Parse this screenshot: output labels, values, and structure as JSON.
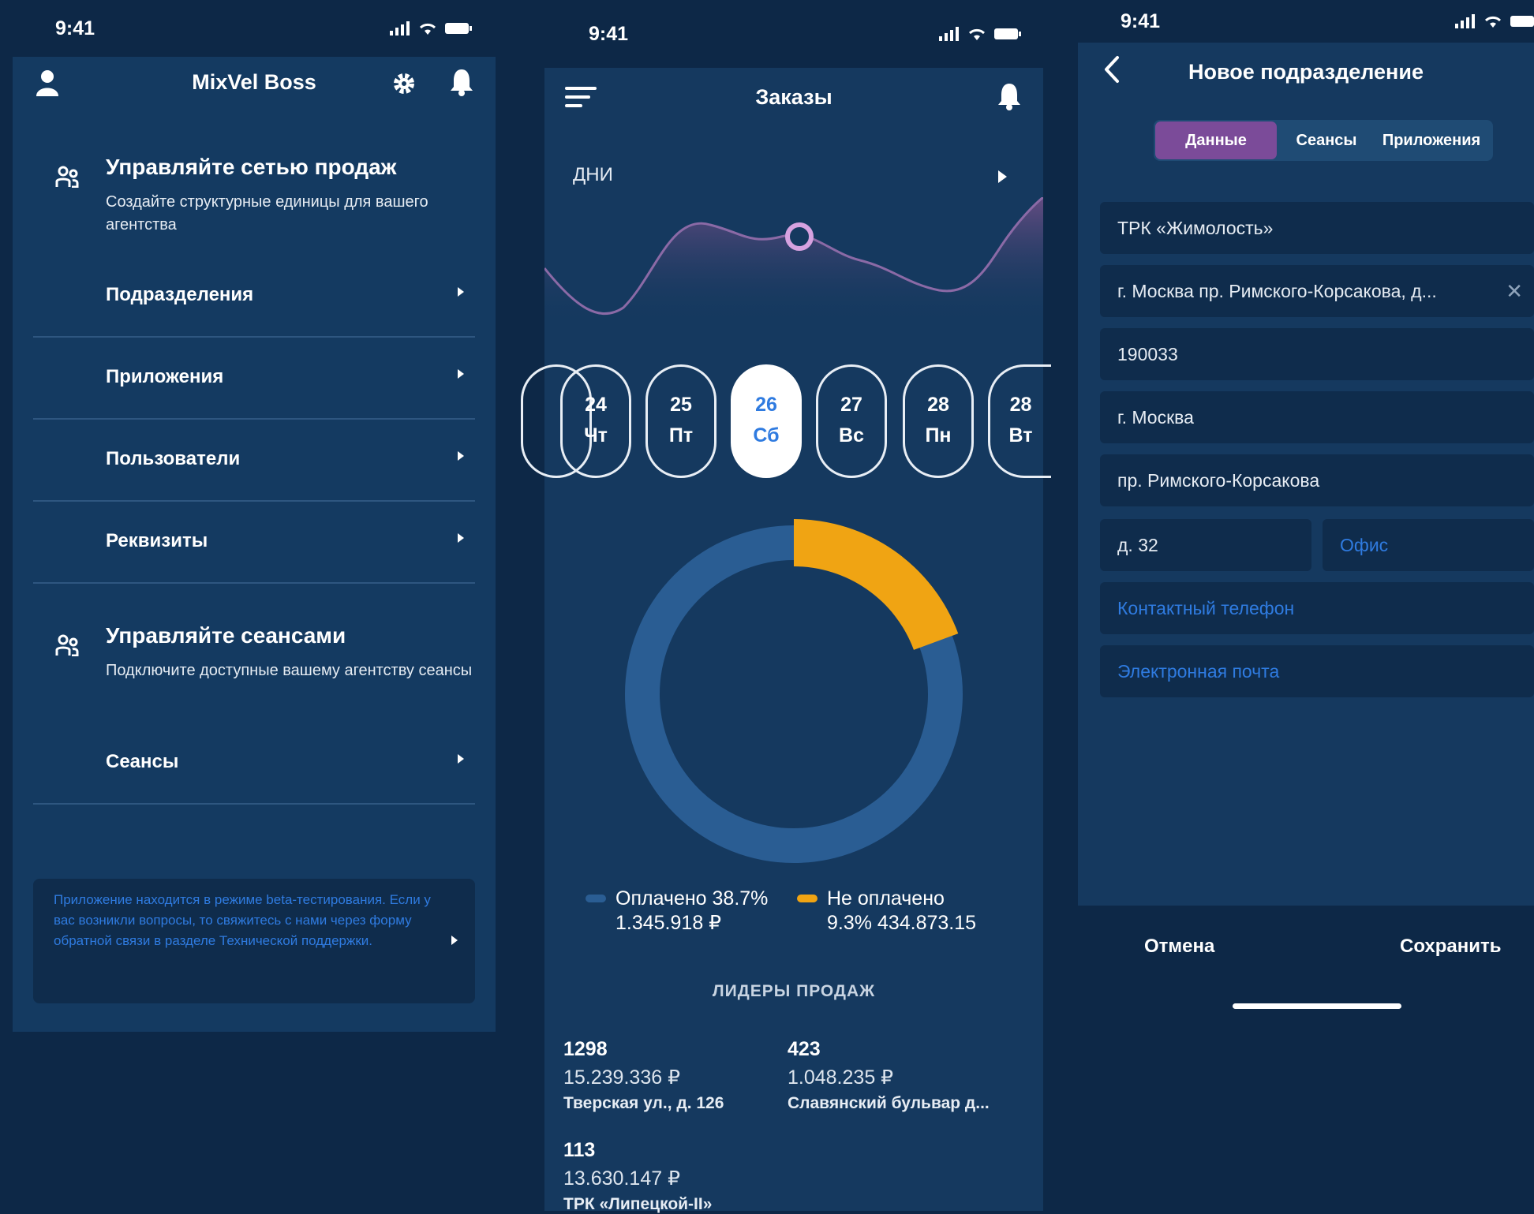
{
  "colors": {
    "background": "#0d2847",
    "panel": "#143a61",
    "accent_blue": "#2f7be0",
    "paid": "#2a5d93",
    "unpaid": "#f0a413",
    "tab_active": "#7b4b99"
  },
  "phone1": {
    "status_time": "9:41",
    "title": "MixVel Boss",
    "icons": {
      "left": "user-icon",
      "settings": "gear-icon",
      "notifications": "bell-icon"
    },
    "section1": {
      "title": "Управляйте сетью продаж",
      "desc": "Создайте структурные единицы для вашего агентства",
      "icon": "team-icon"
    },
    "menu1": [
      {
        "label": "Подразделения"
      },
      {
        "label": "Приложения"
      },
      {
        "label": "Пользователи"
      },
      {
        "label": "Реквизиты"
      }
    ],
    "section2": {
      "title": "Управляйте сеансами",
      "desc": "Подключите доступные вашему агентству сеансы",
      "icon": "team-icon"
    },
    "menu2": [
      {
        "label": "Сеансы"
      }
    ],
    "beta_text": "Приложение находится в режиме beta-тестирования. Если у вас возникли вопросы, то свяжитесь с нами через форму обратной связи в разделе Технической поддержки."
  },
  "phone2": {
    "status_time": "9:41",
    "title": "Заказы",
    "period_label": "ДНИ",
    "days": [
      {
        "num": "24",
        "wd": "Чт"
      },
      {
        "num": "25",
        "wd": "Пт"
      },
      {
        "num": "26",
        "wd": "Сб",
        "active": true
      },
      {
        "num": "27",
        "wd": "Вс"
      },
      {
        "num": "28",
        "wd": "Пн"
      },
      {
        "num": "28",
        "wd": "Вт"
      }
    ],
    "legend": [
      {
        "label": "Оплачено 38.7%",
        "value": "1.345.918 ₽",
        "color": "#2a5d93"
      },
      {
        "label": "Не оплачено",
        "value": "9.3% 434.873.15",
        "color": "#f0a413"
      }
    ],
    "leaders_title": "ЛИДЕРЫ ПРОДАЖ",
    "leaders": [
      {
        "count": "1298",
        "amount": "15.239.336 ₽",
        "address": "Тверская ул., д. 126"
      },
      {
        "count": "423",
        "amount": "1.048.235 ₽",
        "address": "Славянский бульвар д..."
      },
      {
        "count": "113",
        "amount": "13.630.147 ₽",
        "address": "ТРК «Липецкой-II»"
      }
    ]
  },
  "chart_data": {
    "type": "pie",
    "labels": [
      "Оплачено",
      "Не оплачено"
    ],
    "values": [
      38.7,
      9.3
    ],
    "display_values": [
      "1.345.918 ₽",
      "434.873.15"
    ],
    "colors": [
      "#2a5d93",
      "#f0a413"
    ]
  },
  "phone3": {
    "status_time": "9:41",
    "title": "Новое подразделение",
    "tabs": [
      {
        "label": "Данные",
        "active": true
      },
      {
        "label": "Сеансы"
      },
      {
        "label": "Приложения"
      }
    ],
    "fields": {
      "name": "ТРК «Жимолость»",
      "address": "г. Москва пр. Римского-Корсакова, д...",
      "zip": "190033",
      "city": "г. Москва",
      "street": "пр. Римского-Корсакова",
      "house": "д. 32",
      "office_ph": "Офис",
      "phone_ph": "Контактный телефон",
      "email_ph": "Электронная почта"
    },
    "cancel": "Отмена",
    "save": "Сохранить"
  }
}
